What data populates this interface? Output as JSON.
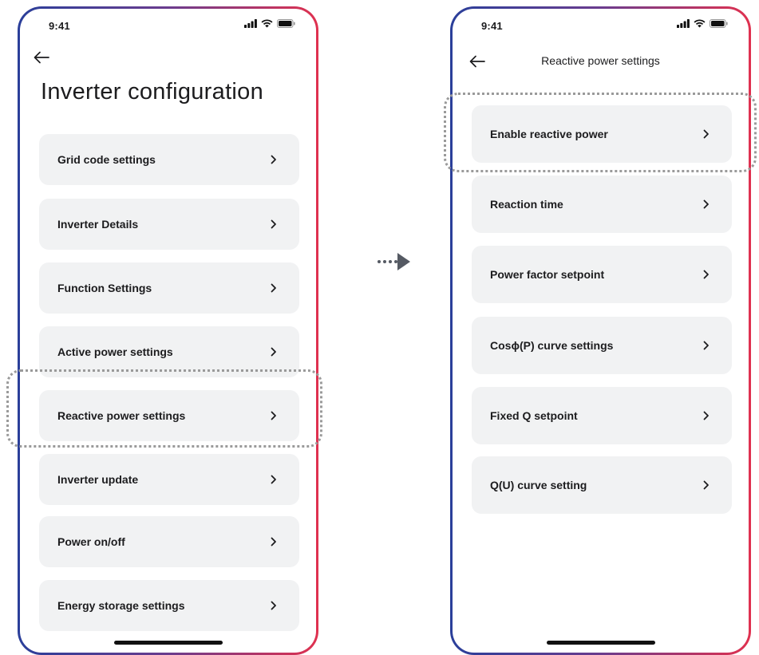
{
  "left_screen": {
    "status_time": "9:41",
    "title": "Inverter configuration",
    "items": [
      {
        "label": "Grid code settings"
      },
      {
        "label": "Inverter Details"
      },
      {
        "label": "Function Settings"
      },
      {
        "label": "Active power settings"
      },
      {
        "label": "Reactive power settings"
      },
      {
        "label": "Inverter update"
      },
      {
        "label": "Power on/off"
      },
      {
        "label": "Energy storage settings"
      }
    ]
  },
  "right_screen": {
    "status_time": "9:41",
    "title": "Reactive power  settings",
    "items": [
      {
        "label": "Enable reactive power"
      },
      {
        "label": "Reaction time"
      },
      {
        "label": "Power factor setpoint"
      },
      {
        "label": "Cosϕ(P) curve settings"
      },
      {
        "label": "Fixed Q setpoint"
      },
      {
        "label": "Q(U) curve setting"
      }
    ]
  },
  "highlighted_items": [
    "Reactive power settings",
    "Enable reactive power"
  ],
  "icons": {
    "back": "back-arrow-icon",
    "chevron": "chevron-right-icon",
    "signal": "cellular-signal-icon",
    "wifi": "wifi-icon",
    "battery": "battery-icon",
    "flow": "flow-arrow-icon"
  },
  "colors": {
    "frame_gradient_start": "#2a3f9a",
    "frame_gradient_end": "#e0314f",
    "item_background": "#f1f2f3",
    "highlight_border": "#9a9a9a",
    "flow_arrow": "#555a63"
  }
}
